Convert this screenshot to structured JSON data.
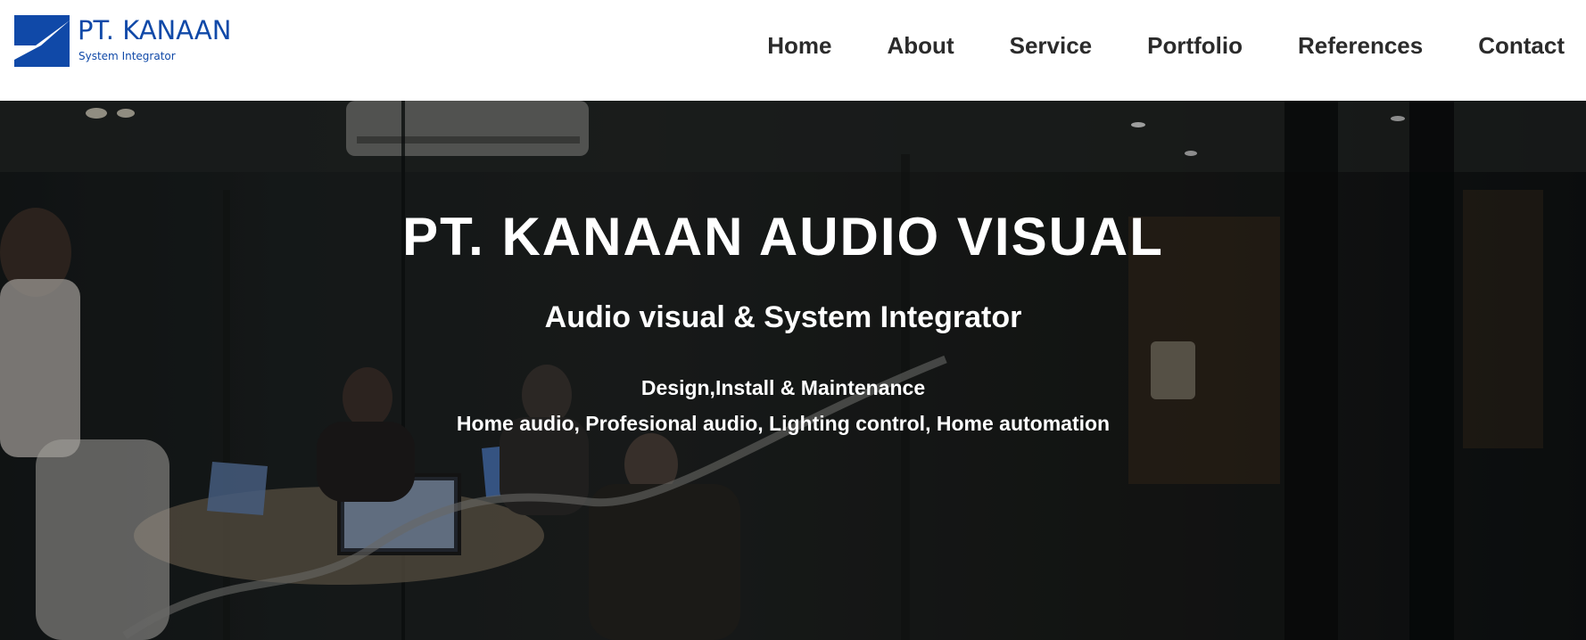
{
  "brand": {
    "name": "PT. KANAAN",
    "tagline": "System Integrator",
    "color": "#1049a8"
  },
  "nav": {
    "items": [
      {
        "label": "Home"
      },
      {
        "label": "About"
      },
      {
        "label": "Service"
      },
      {
        "label": "Portfolio"
      },
      {
        "label": "References"
      },
      {
        "label": "Contact"
      }
    ]
  },
  "hero": {
    "title": "PT. KANAAN AUDIO VISUAL",
    "subtitle": "Audio visual & System Integrator",
    "line1": "Design,Install & Maintenance",
    "line2": "Home audio, Profesional audio, Lighting control, Home automation",
    "background": "office-meeting-room-photo"
  }
}
